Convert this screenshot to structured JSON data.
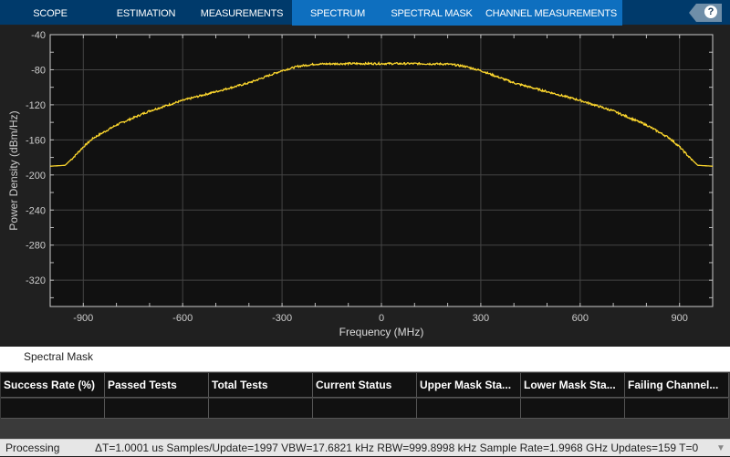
{
  "tabs": [
    {
      "label": "SCOPE"
    },
    {
      "label": "ESTIMATION"
    },
    {
      "label": "MEASUREMENTS"
    },
    {
      "label": "SPECTRUM",
      "highlighted": true
    },
    {
      "label": "SPECTRAL MASK",
      "highlighted": true
    },
    {
      "label": "CHANNEL MEASUREMENTS",
      "highlighted": true
    }
  ],
  "help_label": "?",
  "chart_data": {
    "type": "line",
    "xlabel": "Frequency (MHz)",
    "ylabel": "Power Density (dBm/Hz)",
    "xlim": [
      -1000,
      1000
    ],
    "ylim": [
      -350,
      -40
    ],
    "xticks": [
      -900,
      -600,
      -300,
      0,
      300,
      600,
      900
    ],
    "yticks": [
      -40,
      -80,
      -120,
      -160,
      -200,
      -240,
      -280,
      -320
    ],
    "grid": true,
    "line_color": "#ffd92e",
    "series": [
      {
        "name": "Spectrum",
        "x": [
          -1000,
          -955,
          -930,
          -900,
          -870,
          -800,
          -700,
          -600,
          -500,
          -400,
          -300,
          -250,
          -200,
          -100,
          0,
          100,
          200,
          250,
          300,
          400,
          500,
          600,
          700,
          800,
          870,
          900,
          930,
          955,
          1000
        ],
        "y": [
          -190,
          -189,
          -180,
          -168,
          -158,
          -143,
          -127,
          -115,
          -105,
          -95,
          -81,
          -76,
          -73.5,
          -73,
          -73,
          -73,
          -73.5,
          -76,
          -81,
          -95,
          -105,
          -115,
          -127,
          -143,
          -158,
          -168,
          -180,
          -189,
          -190
        ]
      }
    ]
  },
  "panel": {
    "title": "Spectral Mask",
    "columns": [
      "Success Rate (%)",
      "Passed Tests",
      "Total Tests",
      "Current Status",
      "Upper Mask Sta...",
      "Lower Mask Sta...",
      "Failing Channel..."
    ]
  },
  "status": {
    "state": "Processing",
    "info": "ΔT=1.0001 us  Samples/Update=1997  VBW=17.6821 kHz  RBW=999.8998 kHz  Sample Rate=1.9968 GHz  Updates=159  T=0"
  }
}
